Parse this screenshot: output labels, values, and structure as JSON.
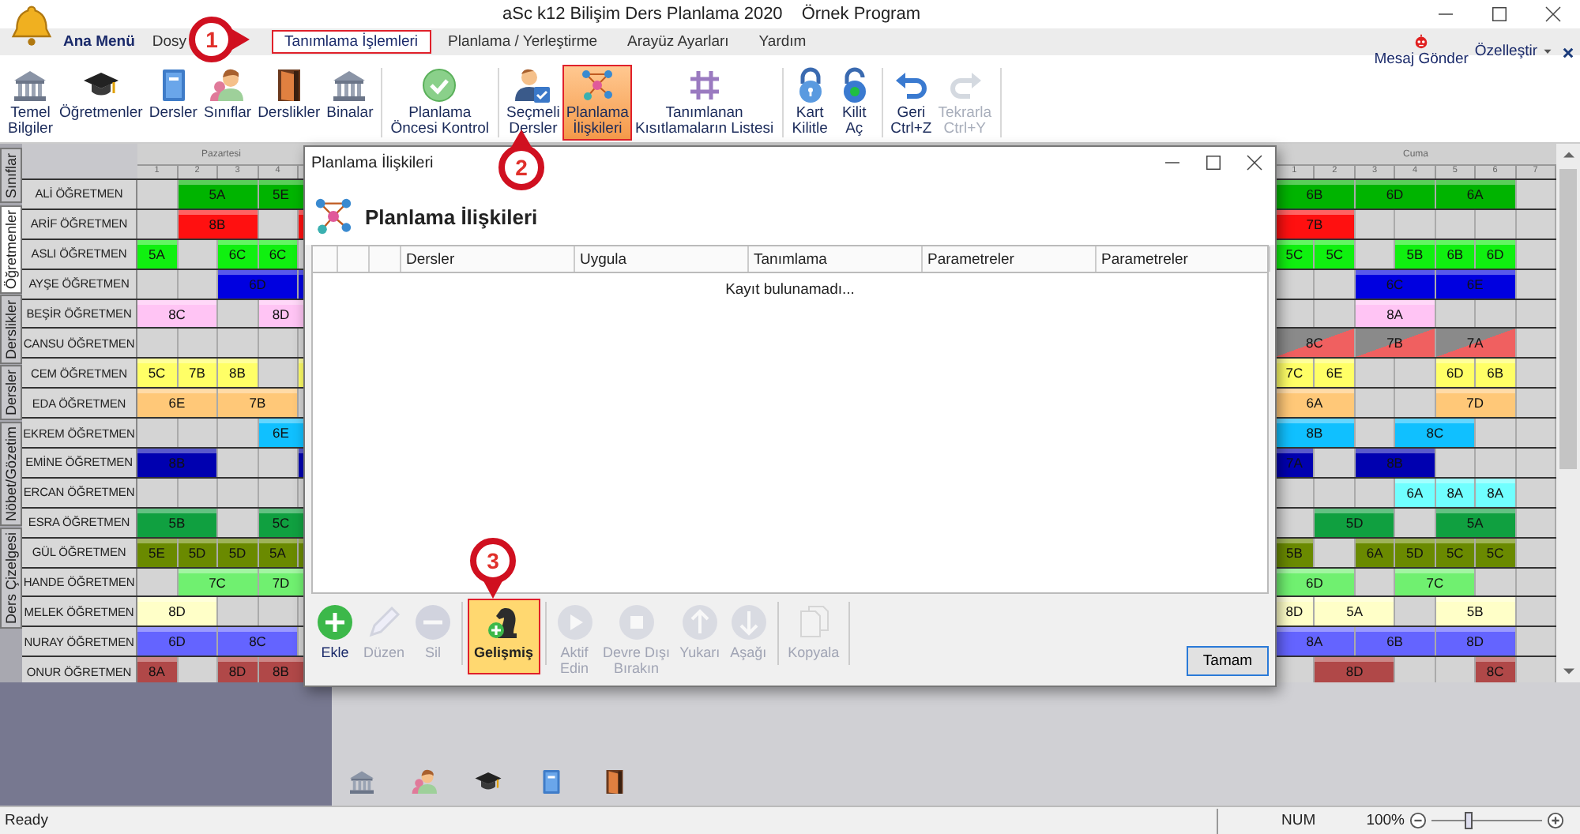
{
  "window": {
    "title": "aSc k12 Bilişim Ders Planlama 2020",
    "subtitle": "Örnek Program"
  },
  "menu": {
    "items": [
      {
        "label": "Ana Menü",
        "kind": "app",
        "selected": false
      },
      {
        "label": "Dosy",
        "kind": "tab",
        "selected": false
      },
      {
        "label": "Tanımlama İşlemleri",
        "kind": "tab",
        "selected": true
      },
      {
        "label": "Planlama / Yerleştirme",
        "kind": "tab",
        "selected": false
      },
      {
        "label": "Arayüz Ayarları",
        "kind": "tab",
        "selected": false
      },
      {
        "label": "Yardım",
        "kind": "tab",
        "selected": false
      }
    ],
    "message_button": "Mesaj Gönder",
    "customize": "Özelleştir"
  },
  "ribbon": {
    "groups": [
      {
        "buttons": [
          {
            "label": "Temel\nBilgiler",
            "highlighted": false,
            "disabled": false
          },
          {
            "label": "Öğretmenler",
            "highlighted": false,
            "disabled": false
          },
          {
            "label": "Dersler",
            "highlighted": false,
            "disabled": false
          },
          {
            "label": "Sınıflar",
            "highlighted": false,
            "disabled": false
          },
          {
            "label": "Derslikler",
            "highlighted": false,
            "disabled": false
          },
          {
            "label": "Binalar",
            "highlighted": false,
            "disabled": false
          }
        ]
      },
      {
        "buttons": [
          {
            "label": "Planlama\nÖncesi Kontrol",
            "highlighted": false,
            "disabled": false
          }
        ]
      },
      {
        "buttons": [
          {
            "label": "Seçmeli\nDersler",
            "highlighted": false,
            "disabled": false
          },
          {
            "label": "Planlama\nİlişkileri",
            "highlighted": true,
            "disabled": false
          },
          {
            "label": "Tanımlanan\nKısıtlamaların Listesi",
            "highlighted": false,
            "disabled": false
          }
        ]
      },
      {
        "buttons": [
          {
            "label": "Kart\nKilitle",
            "highlighted": false,
            "disabled": false
          },
          {
            "label": "Kilit\nAç",
            "highlighted": false,
            "disabled": false
          }
        ]
      },
      {
        "buttons": [
          {
            "label": "Geri\nCtrl+Z",
            "highlighted": false,
            "disabled": false
          },
          {
            "label": "Tekrarla\nCtrl+Y",
            "highlighted": false,
            "disabled": true
          }
        ]
      }
    ]
  },
  "side_tabs": [
    {
      "label": "Sınıflar",
      "selected": false
    },
    {
      "label": "Öğretmenler",
      "selected": true
    },
    {
      "label": "Derslikler",
      "selected": false
    },
    {
      "label": "Dersler",
      "selected": false
    },
    {
      "label": "Nöbet/Gözetim",
      "selected": false
    },
    {
      "label": "Ders Çizelgesi",
      "selected": false
    }
  ],
  "timetable": {
    "left_day": "Pazartesi",
    "left_periods": [
      "1",
      "2",
      "3",
      "4"
    ],
    "right_day": "Cuma",
    "right_periods": [
      "1",
      "2",
      "3",
      "4",
      "5",
      "6",
      "7"
    ],
    "rows": [
      {
        "teacher": "ALİ ÖĞRETMEN",
        "left": [
          {
            "kind": "empty"
          },
          {
            "kind": "lesson",
            "label": "5A",
            "color": "#00b400"
          },
          {
            "kind": "continued"
          },
          {
            "kind": "lesson",
            "label": "5E",
            "color": "#00b400"
          },
          {
            "kind": "continued"
          }
        ],
        "right": [
          {
            "kind": "lesson",
            "label": "6B",
            "color": "#00b400"
          },
          {
            "kind": "continued"
          },
          {
            "kind": "lesson",
            "label": "6D",
            "color": "#00b400"
          },
          {
            "kind": "continued"
          },
          {
            "kind": "lesson",
            "label": "6A",
            "color": "#00b400"
          },
          {
            "kind": "continued"
          },
          {
            "kind": "empty"
          }
        ]
      },
      {
        "teacher": "ARİF ÖĞRETMEN",
        "left": [
          {
            "kind": "empty"
          },
          {
            "kind": "lesson",
            "label": "8B",
            "color": "#ff1010"
          },
          {
            "kind": "continued"
          },
          {
            "kind": "empty"
          },
          {
            "kind": "lesson",
            "color": "#ff1010"
          }
        ],
        "right": [
          {
            "kind": "lesson",
            "label": "7B",
            "color": "#ff1010"
          },
          {
            "kind": "continued"
          },
          {
            "kind": "empty"
          },
          {
            "kind": "empty"
          },
          {
            "kind": "empty"
          },
          {
            "kind": "empty"
          },
          {
            "kind": "empty"
          }
        ]
      },
      {
        "teacher": "ASLI ÖĞRETMEN",
        "left": [
          {
            "kind": "lesson",
            "label": "5A",
            "color": "#10f010"
          },
          {
            "kind": "empty"
          },
          {
            "kind": "lesson",
            "label": "6C",
            "color": "#10f010"
          },
          {
            "kind": "lesson",
            "label": "6C",
            "color": "#10f010"
          },
          {
            "kind": "empty"
          }
        ],
        "right": [
          {
            "kind": "lesson",
            "label": "5C",
            "color": "#10f010"
          },
          {
            "kind": "lesson",
            "label": "5C",
            "color": "#10f010"
          },
          {
            "kind": "empty"
          },
          {
            "kind": "lesson",
            "label": "5B",
            "color": "#10f010"
          },
          {
            "kind": "lesson",
            "label": "6B",
            "color": "#10f010"
          },
          {
            "kind": "lesson",
            "label": "6D",
            "color": "#10f010"
          },
          {
            "kind": "empty"
          }
        ]
      },
      {
        "teacher": "AYŞE ÖĞRETMEN",
        "left": [
          {
            "kind": "empty"
          },
          {
            "kind": "empty"
          },
          {
            "kind": "lesson",
            "label": "6D",
            "color": "#0000e0"
          },
          {
            "kind": "continued"
          },
          {
            "kind": "lesson",
            "color": "#0000e0"
          }
        ],
        "right": [
          {
            "kind": "empty"
          },
          {
            "kind": "empty"
          },
          {
            "kind": "lesson",
            "label": "6C",
            "color": "#0000e0"
          },
          {
            "kind": "continued"
          },
          {
            "kind": "lesson",
            "label": "6E",
            "color": "#0000e0"
          },
          {
            "kind": "continued"
          },
          {
            "kind": "empty"
          }
        ]
      },
      {
        "teacher": "BEŞİR ÖĞRETMEN",
        "left": [
          {
            "kind": "lesson",
            "label": "8C",
            "color": "#ffc4f4"
          },
          {
            "kind": "continued"
          },
          {
            "kind": "empty"
          },
          {
            "kind": "lesson",
            "label": "8D",
            "color": "#ffc4f4"
          },
          {
            "kind": "continued"
          }
        ],
        "right": [
          {
            "kind": "empty"
          },
          {
            "kind": "empty"
          },
          {
            "kind": "lesson",
            "label": "8A",
            "color": "#ffc4f4"
          },
          {
            "kind": "continued"
          },
          {
            "kind": "empty"
          },
          {
            "kind": "empty"
          },
          {
            "kind": "empty"
          }
        ]
      },
      {
        "teacher": "CANSU ÖĞRETMEN",
        "left": [
          {
            "kind": "empty"
          },
          {
            "kind": "empty"
          },
          {
            "kind": "empty"
          },
          {
            "kind": "empty"
          },
          {
            "kind": "empty"
          }
        ],
        "right": [
          {
            "kind": "conflict",
            "label": "8C"
          },
          {
            "kind": "continued"
          },
          {
            "kind": "conflict",
            "label": "7B"
          },
          {
            "kind": "continued"
          },
          {
            "kind": "conflict",
            "label": "7A"
          },
          {
            "kind": "continued"
          },
          {
            "kind": "empty"
          }
        ]
      },
      {
        "teacher": "CEM ÖĞRETMEN",
        "left": [
          {
            "kind": "lesson",
            "label": "5C",
            "color": "#ffff66"
          },
          {
            "kind": "lesson",
            "label": "7B",
            "color": "#ffff66"
          },
          {
            "kind": "lesson",
            "label": "8B",
            "color": "#ffff66"
          },
          {
            "kind": "empty"
          },
          {
            "kind": "lesson",
            "color": "#ffff66"
          }
        ],
        "right": [
          {
            "kind": "lesson",
            "label": "7C",
            "color": "#ffff66"
          },
          {
            "kind": "lesson",
            "label": "6E",
            "color": "#ffff66"
          },
          {
            "kind": "empty"
          },
          {
            "kind": "empty"
          },
          {
            "kind": "lesson",
            "label": "6D",
            "color": "#ffff66"
          },
          {
            "kind": "lesson",
            "label": "6B",
            "color": "#ffff66"
          },
          {
            "kind": "empty"
          }
        ]
      },
      {
        "teacher": "EDA ÖĞRETMEN",
        "left": [
          {
            "kind": "lesson",
            "label": "6E",
            "color": "#ffc878"
          },
          {
            "kind": "continued"
          },
          {
            "kind": "lesson",
            "label": "7B",
            "color": "#ffc878"
          },
          {
            "kind": "continued"
          },
          {
            "kind": "empty"
          }
        ],
        "right": [
          {
            "kind": "lesson",
            "label": "6A",
            "color": "#ffc878"
          },
          {
            "kind": "continued"
          },
          {
            "kind": "empty"
          },
          {
            "kind": "empty"
          },
          {
            "kind": "lesson",
            "label": "7D",
            "color": "#ffc878"
          },
          {
            "kind": "continued"
          },
          {
            "kind": "empty"
          }
        ]
      },
      {
        "teacher": "EKREM ÖĞRETMEN",
        "left": [
          {
            "kind": "empty"
          },
          {
            "kind": "empty"
          },
          {
            "kind": "empty"
          },
          {
            "kind": "lesson",
            "label": "6E",
            "color": "#10c0ff"
          },
          {
            "kind": "continued"
          }
        ],
        "right": [
          {
            "kind": "lesson",
            "label": "8B",
            "color": "#10c0ff"
          },
          {
            "kind": "continued"
          },
          {
            "kind": "empty"
          },
          {
            "kind": "lesson",
            "label": "8C",
            "color": "#10c0ff"
          },
          {
            "kind": "continued"
          },
          {
            "kind": "empty"
          },
          {
            "kind": "empty"
          }
        ]
      },
      {
        "teacher": "EMİNE ÖĞRETMEN",
        "left": [
          {
            "kind": "lesson",
            "label": "8B",
            "color": "#0000b0"
          },
          {
            "kind": "continued"
          },
          {
            "kind": "empty"
          },
          {
            "kind": "empty"
          },
          {
            "kind": "lesson",
            "color": "#0000b0"
          }
        ],
        "right": [
          {
            "kind": "lesson",
            "label": "7A",
            "color": "#0000b0"
          },
          {
            "kind": "empty"
          },
          {
            "kind": "lesson",
            "label": "8B",
            "color": "#0000b0"
          },
          {
            "kind": "continued"
          },
          {
            "kind": "empty"
          },
          {
            "kind": "empty"
          },
          {
            "kind": "empty"
          }
        ]
      },
      {
        "teacher": "ERCAN ÖĞRETMEN",
        "left": [
          {
            "kind": "empty"
          },
          {
            "kind": "empty"
          },
          {
            "kind": "empty"
          },
          {
            "kind": "empty"
          },
          {
            "kind": "empty"
          }
        ],
        "right": [
          {
            "kind": "empty"
          },
          {
            "kind": "empty"
          },
          {
            "kind": "empty"
          },
          {
            "kind": "lesson",
            "label": "6A",
            "color": "#70ffff"
          },
          {
            "kind": "lesson",
            "label": "8A",
            "color": "#70ffff"
          },
          {
            "kind": "lesson",
            "label": "8A",
            "color": "#70ffff"
          },
          {
            "kind": "empty"
          }
        ]
      },
      {
        "teacher": "ESRA ÖĞRETMEN",
        "left": [
          {
            "kind": "lesson",
            "label": "5B",
            "color": "#10a040"
          },
          {
            "kind": "continued"
          },
          {
            "kind": "empty"
          },
          {
            "kind": "lesson",
            "label": "5C",
            "color": "#10a040"
          },
          {
            "kind": "continued"
          }
        ],
        "right": [
          {
            "kind": "empty"
          },
          {
            "kind": "lesson",
            "label": "5D",
            "color": "#10a040"
          },
          {
            "kind": "continued"
          },
          {
            "kind": "empty"
          },
          {
            "kind": "lesson",
            "label": "5A",
            "color": "#10a040"
          },
          {
            "kind": "continued"
          },
          {
            "kind": "empty"
          }
        ]
      },
      {
        "teacher": "GÜL ÖĞRETMEN",
        "left": [
          {
            "kind": "lesson",
            "label": "5E",
            "color": "#6a8a00"
          },
          {
            "kind": "lesson",
            "label": "5D",
            "color": "#6a8a00"
          },
          {
            "kind": "lesson",
            "label": "5D",
            "color": "#6a8a00"
          },
          {
            "kind": "lesson",
            "label": "5A",
            "color": "#6a8a00"
          },
          {
            "kind": "lesson",
            "color": "#6a8a00"
          }
        ],
        "right": [
          {
            "kind": "lesson",
            "label": "5B",
            "color": "#6a8a00"
          },
          {
            "kind": "empty"
          },
          {
            "kind": "lesson",
            "label": "6A",
            "color": "#6a8a00"
          },
          {
            "kind": "lesson",
            "label": "5D",
            "color": "#6a8a00"
          },
          {
            "kind": "lesson",
            "label": "5C",
            "color": "#6a8a00"
          },
          {
            "kind": "lesson",
            "label": "5C",
            "color": "#6a8a00"
          },
          {
            "kind": "empty"
          }
        ]
      },
      {
        "teacher": "HANDE ÖĞRETMEN",
        "left": [
          {
            "kind": "empty"
          },
          {
            "kind": "lesson",
            "label": "7C",
            "color": "#70f070"
          },
          {
            "kind": "continued"
          },
          {
            "kind": "lesson",
            "label": "7D",
            "color": "#70f070"
          },
          {
            "kind": "continued"
          }
        ],
        "right": [
          {
            "kind": "lesson",
            "label": "6D",
            "color": "#70f070"
          },
          {
            "kind": "continued"
          },
          {
            "kind": "empty"
          },
          {
            "kind": "lesson",
            "label": "7C",
            "color": "#70f070"
          },
          {
            "kind": "continued"
          },
          {
            "kind": "empty"
          },
          {
            "kind": "empty"
          }
        ]
      },
      {
        "teacher": "MELEK ÖĞRETMEN",
        "left": [
          {
            "kind": "lesson",
            "label": "8D",
            "color": "#ffffc8"
          },
          {
            "kind": "continued"
          },
          {
            "kind": "empty"
          },
          {
            "kind": "empty"
          },
          {
            "kind": "empty"
          }
        ],
        "right": [
          {
            "kind": "lesson",
            "label": "8D",
            "color": "#ffffc8"
          },
          {
            "kind": "lesson",
            "label": "5A",
            "color": "#ffffc8"
          },
          {
            "kind": "continued"
          },
          {
            "kind": "empty"
          },
          {
            "kind": "lesson",
            "label": "5B",
            "color": "#ffffc8"
          },
          {
            "kind": "continued"
          },
          {
            "kind": "empty"
          }
        ]
      },
      {
        "teacher": "NURAY ÖĞRETMEN",
        "left": [
          {
            "kind": "lesson",
            "label": "6D",
            "color": "#6464ff"
          },
          {
            "kind": "continued"
          },
          {
            "kind": "lesson",
            "label": "8C",
            "color": "#6464ff"
          },
          {
            "kind": "continued"
          },
          {
            "kind": "empty"
          }
        ],
        "right": [
          {
            "kind": "lesson",
            "label": "8A",
            "color": "#6464ff"
          },
          {
            "kind": "continued"
          },
          {
            "kind": "lesson",
            "label": "6B",
            "color": "#6464ff"
          },
          {
            "kind": "continued"
          },
          {
            "kind": "lesson",
            "label": "8D",
            "color": "#6464ff"
          },
          {
            "kind": "continued"
          },
          {
            "kind": "empty"
          }
        ]
      },
      {
        "teacher": "ONUR ÖĞRETMEN",
        "left": [
          {
            "kind": "lesson",
            "label": "8A",
            "color": "#b04848"
          },
          {
            "kind": "empty"
          },
          {
            "kind": "lesson",
            "label": "8D",
            "color": "#b04848"
          },
          {
            "kind": "lesson",
            "label": "8B",
            "color": "#b04848"
          },
          {
            "kind": "continued"
          }
        ],
        "right": [
          {
            "kind": "empty"
          },
          {
            "kind": "lesson",
            "label": "8D",
            "color": "#b04848"
          },
          {
            "kind": "continued"
          },
          {
            "kind": "empty"
          },
          {
            "kind": "empty"
          },
          {
            "kind": "lesson",
            "label": "8C",
            "color": "#b04848"
          },
          {
            "kind": "empty"
          }
        ]
      }
    ]
  },
  "dialog": {
    "title": "Planlama İlişkileri",
    "heading": "Planlama İlişkileri",
    "columns": [
      "Dersler",
      "Uygula",
      "Tanımlama",
      "Parametreler",
      "Parametreler"
    ],
    "empty_message": "Kayıt bulunamadı...",
    "toolbar_groups": [
      {
        "buttons": [
          {
            "label": "Ekle",
            "disabled": false,
            "highlighted": false
          },
          {
            "label": "Düzen",
            "disabled": true,
            "highlighted": false
          },
          {
            "label": "Sil",
            "disabled": true,
            "highlighted": false
          }
        ]
      },
      {
        "buttons": [
          {
            "label": "Gelişmiş",
            "disabled": false,
            "highlighted": true
          }
        ]
      },
      {
        "buttons": [
          {
            "label": "Aktif\nEdin",
            "disabled": true,
            "highlighted": false
          },
          {
            "label": "Devre Dışı\nBırakın",
            "disabled": true,
            "highlighted": false
          },
          {
            "label": "Yukarı",
            "disabled": true,
            "highlighted": false
          },
          {
            "label": "Aşağı",
            "disabled": true,
            "highlighted": false
          }
        ]
      },
      {
        "buttons": [
          {
            "label": "Kopyala",
            "disabled": true,
            "highlighted": false
          }
        ]
      }
    ],
    "ok_button": "Tamam"
  },
  "callouts": [
    {
      "number": "1"
    },
    {
      "number": "2"
    },
    {
      "number": "3"
    }
  ],
  "status_bar": {
    "text": "Ready",
    "num": "NUM",
    "zoom": "100%",
    "zoom_slider": {
      "level": 0.3
    }
  }
}
